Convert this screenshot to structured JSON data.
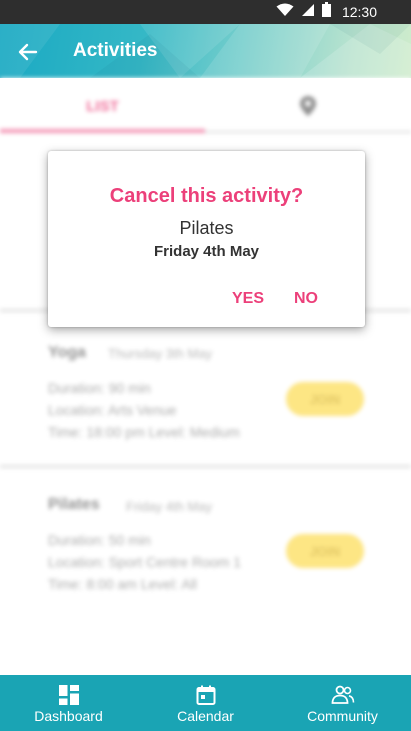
{
  "status_bar": {
    "time": "12:30",
    "icons": [
      "wifi-icon",
      "signal-icon",
      "battery-icon"
    ]
  },
  "app_bar": {
    "title": "Activities",
    "back_icon": "arrow-left-icon"
  },
  "tabs": {
    "list_label": "LIST",
    "map_icon": "location-pin-icon"
  },
  "cards": [
    {
      "title": "Yoga",
      "date": "Thursday 3th May",
      "duration": "Duration: 90 min",
      "location": "Location: Arts Venue",
      "time_level": "Time: 18:00 pm  Level: Medium",
      "join_label": "JOIN"
    },
    {
      "title": "Pilates",
      "date": "Friday 4th May",
      "duration": "Duration: 50 min",
      "location": "Location: Sport Centre Room 1",
      "time_level": "Time: 8:00 am  Level: All",
      "join_label": "JOIN"
    }
  ],
  "dialog": {
    "title": "Cancel this activity?",
    "activity": "Pilates",
    "date": "Friday 4th May",
    "yes_label": "YES",
    "no_label": "NO"
  },
  "bottom_nav": [
    {
      "label": "Dashboard",
      "icon": "dashboard-icon"
    },
    {
      "label": "Calendar",
      "icon": "calendar-icon"
    },
    {
      "label": "Community",
      "icon": "community-icon"
    }
  ],
  "colors": {
    "primary": "#1aa4b4",
    "accent": "#ec407a",
    "join": "#fde47a"
  }
}
